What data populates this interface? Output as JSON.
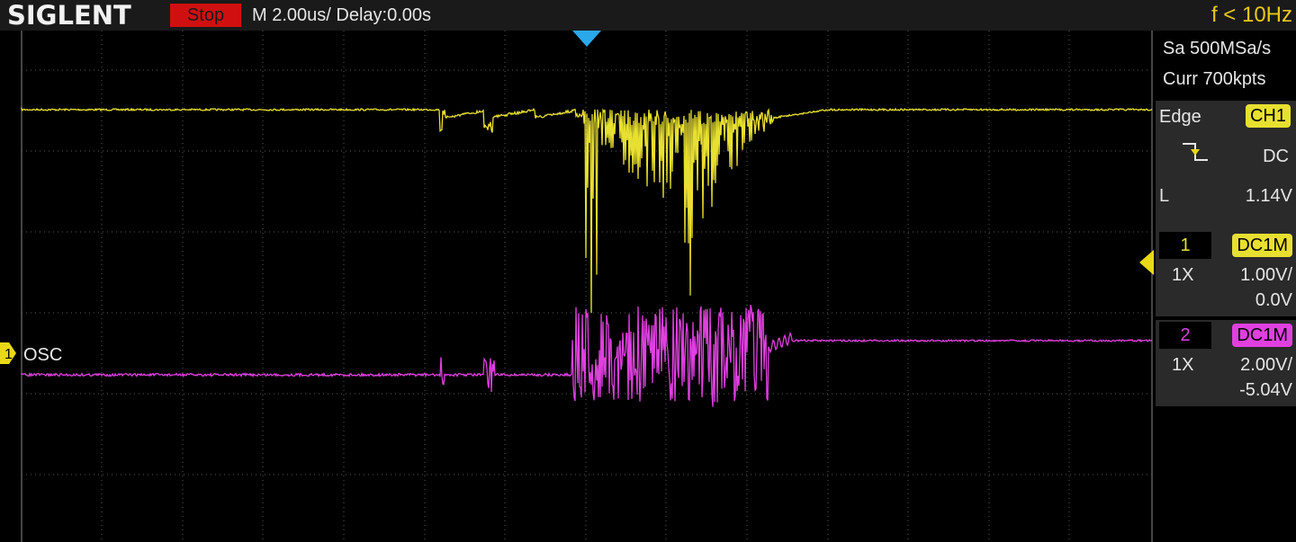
{
  "header": {
    "brand": "SIGLENT",
    "run_state": "Stop",
    "timebase": "M 2.00us/  Delay:0.00s",
    "frequency": "f < 10Hz"
  },
  "acquisition": {
    "sample_rate": "Sa 500MSa/s",
    "memory_depth": "Curr 700kpts"
  },
  "trigger": {
    "type": "Edge",
    "source": "CH1",
    "slope_icon": "falling-edge-icon",
    "coupling": "DC",
    "level_prefix": "L",
    "level": "1.14V"
  },
  "channels": [
    {
      "number": "1",
      "coupling": "DC1M",
      "probe": "1X",
      "scale": "1.00V/",
      "offset": "0.0V",
      "color": "#e8e030"
    },
    {
      "number": "2",
      "coupling": "DC1M",
      "probe": "1X",
      "scale": "2.00V/",
      "offset": "-5.04V",
      "color": "#e040e0"
    }
  ],
  "markers": {
    "ch1_label": "OSC",
    "ch1_number": "1"
  },
  "colors": {
    "stop": "#d01010",
    "trigger_position": "#2aa8ea",
    "grid": "#5a5a5a"
  }
}
